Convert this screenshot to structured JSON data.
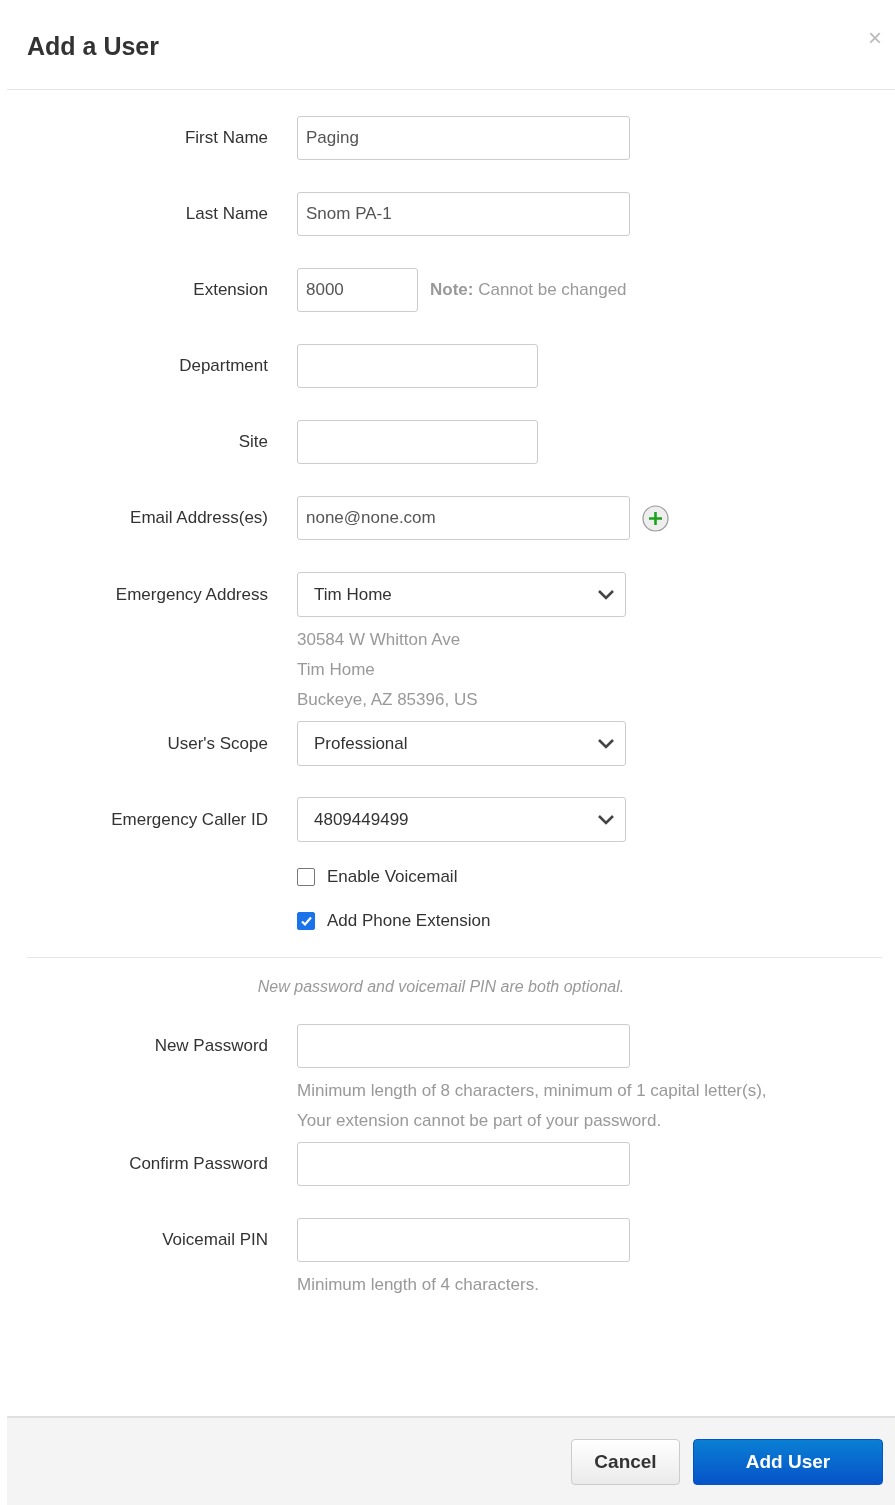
{
  "dialog": {
    "title": "Add a User",
    "close": "×"
  },
  "fields": [
    {
      "kind": "wide",
      "label": "First Name",
      "value": "Paging"
    },
    {
      "kind": "wide",
      "label": "Last Name",
      "value": "Snom PA-1"
    },
    {
      "kind": "narrow",
      "label": "Extension",
      "value": "8000",
      "note": "**Note:** Cannot be changed"
    },
    {
      "kind": "medium",
      "label": "Department"
    },
    {
      "kind": "medium",
      "label": "Site"
    },
    {
      "kind": "email",
      "label": "Email Address(es)",
      "value": "none@none.com"
    },
    {
      "kind": "select",
      "label": "Emergency Address",
      "value": "Tim Home",
      "help": [
        "30584 W Whitton Ave",
        "Tim Home",
        "Buckeye, AZ 85396, US"
      ]
    },
    {
      "kind": "select",
      "label": "User's Scope",
      "value": "Professional"
    },
    {
      "kind": "select",
      "label": "Emergency Caller ID",
      "value": "4809449499"
    },
    {
      "kind": "checkbox",
      "label": "Enable Voicemail",
      "checked": false
    },
    {
      "kind": "checkbox",
      "label": "Add Phone Extension",
      "checked": true
    }
  ],
  "password_note": "New password and voicemail PIN are both optional.",
  "password_fields": [
    {
      "kind": "wide",
      "label": "New Password",
      "help": [
        "Minimum length of 8 characters, minimum of 1 capital letter(s),",
        "Your extension cannot be part of your password."
      ]
    },
    {
      "kind": "wide",
      "label": "Confirm Password"
    },
    {
      "kind": "wide",
      "label": "Voicemail PIN",
      "help": [
        "Minimum length of 4 characters."
      ]
    }
  ],
  "buttons": [
    {
      "kind": "secondary",
      "label": "Cancel"
    },
    {
      "kind": "primary",
      "label": "Add User"
    }
  ]
}
